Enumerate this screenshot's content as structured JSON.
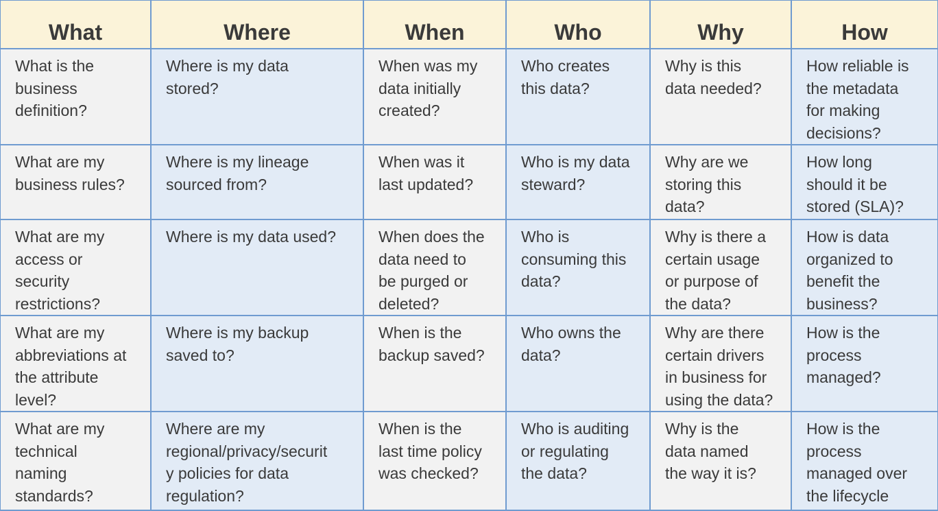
{
  "table": {
    "headers": [
      "What",
      "Where",
      "When",
      "Who",
      "Why",
      "How"
    ],
    "rows": [
      [
        [
          "What is the",
          "business",
          "definition?"
        ],
        [
          "Where is my data",
          "stored?"
        ],
        [
          "When was my",
          "data initially",
          "created?"
        ],
        [
          "Who creates",
          "this data?"
        ],
        [
          "Why is this",
          "data needed?"
        ],
        [
          "How reliable is",
          "the metadata",
          "for making",
          "decisions?"
        ]
      ],
      [
        [
          "What are my",
          "business rules?"
        ],
        [
          "Where is my lineage",
          "sourced from?"
        ],
        [
          "When was it",
          "last updated?"
        ],
        [
          "Who is my data",
          "steward?"
        ],
        [
          "Why are we",
          "storing this",
          "data?"
        ],
        [
          "How long",
          "should it be",
          "stored (SLA)?"
        ]
      ],
      [
        [
          "What are my",
          "access or",
          "security",
          "restrictions?"
        ],
        [
          "Where is my data used?"
        ],
        [
          "When does the",
          "data need to",
          "be purged or",
          "deleted?"
        ],
        [
          "Who is",
          "consuming this",
          "data?"
        ],
        [
          "Why is there a",
          "certain usage",
          "or purpose of",
          "the data?"
        ],
        [
          "How is data",
          "organized to",
          "benefit the",
          "business?"
        ]
      ],
      [
        [
          "What are my",
          "abbreviations at",
          "the attribute",
          "level?"
        ],
        [
          "Where is my backup",
          "saved to?"
        ],
        [
          "When is the",
          "backup saved?"
        ],
        [
          "Who owns the",
          "data?"
        ],
        [
          "Why are there",
          "certain drivers",
          "in business for",
          "using the data?"
        ],
        [
          "How is the",
          "process",
          "managed?"
        ]
      ],
      [
        [
          "What are my",
          "technical",
          "naming",
          "standards?"
        ],
        [
          "Where are my",
          "regional/privacy/securit",
          "y policies for data",
          "regulation?"
        ],
        [
          "When is the",
          "last time policy",
          "was checked?"
        ],
        [
          "Who is auditing",
          "or regulating",
          "the data?"
        ],
        [
          "Why is the",
          "data named",
          "the way it is?"
        ],
        [
          "How is the",
          "process",
          "managed over",
          "the lifecycle"
        ]
      ]
    ]
  }
}
